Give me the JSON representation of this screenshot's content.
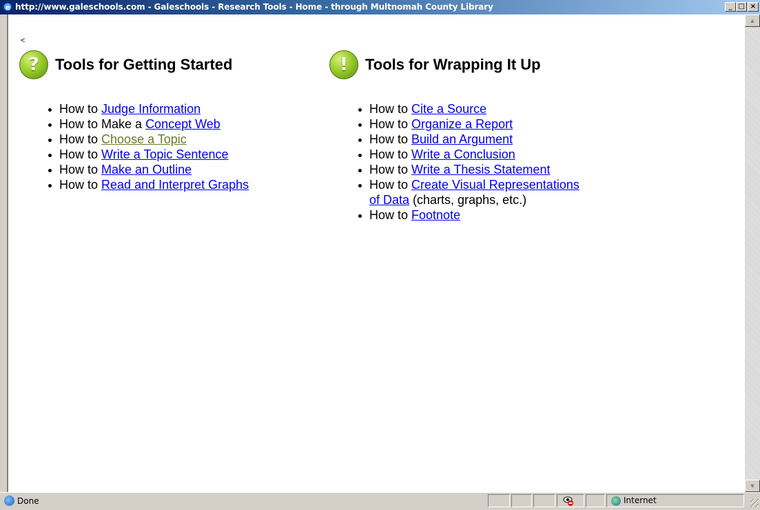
{
  "window": {
    "title": "http://www.galeschools.com - Galeschools - Research Tools - Home - through Multnomah County Library",
    "min_label": "_",
    "max_label": "□",
    "close_label": "×"
  },
  "page": {
    "back_mark": "<",
    "left_section": {
      "icon_glyph": "?",
      "title": "Tools for Getting Started",
      "items": [
        {
          "prefix": "How to ",
          "link": "Judge Information",
          "suffix": ""
        },
        {
          "prefix": "How to Make a ",
          "link": "Concept Web",
          "suffix": ""
        },
        {
          "prefix": "How to ",
          "link": "Choose a Topic",
          "suffix": ""
        },
        {
          "prefix": "How to ",
          "link": "Write a Topic Sentence",
          "suffix": ""
        },
        {
          "prefix": "How to ",
          "link": "Make an Outline",
          "suffix": ""
        },
        {
          "prefix": "How to ",
          "link": "Read and Interpret Graphs",
          "suffix": ""
        }
      ]
    },
    "right_section": {
      "icon_glyph": "!",
      "title": "Tools for Wrapping It Up",
      "items": [
        {
          "prefix": "How to ",
          "link": "Cite a Source",
          "suffix": ""
        },
        {
          "prefix": "How to ",
          "link": "Organize a Report",
          "suffix": ""
        },
        {
          "prefix": "How to ",
          "link": "Build an Argument",
          "suffix": ""
        },
        {
          "prefix": "How to ",
          "link": "Write a Conclusion",
          "suffix": ""
        },
        {
          "prefix": "How to ",
          "link": "Write a Thesis Statement",
          "suffix": ""
        },
        {
          "prefix": "How to ",
          "link": "Create Visual Representations of Data",
          "suffix": " (charts, graphs, etc.)"
        },
        {
          "prefix": "How to ",
          "link": "Footnote",
          "suffix": ""
        }
      ]
    },
    "visited_link_color": "#6b7a2a",
    "link_color": "#0000ee"
  },
  "statusbar": {
    "status": "Done",
    "zone": "Internet"
  },
  "icons": [
    "ie-icon",
    "help-icon",
    "exclamation-icon",
    "privacy-icon",
    "globe-icon"
  ]
}
